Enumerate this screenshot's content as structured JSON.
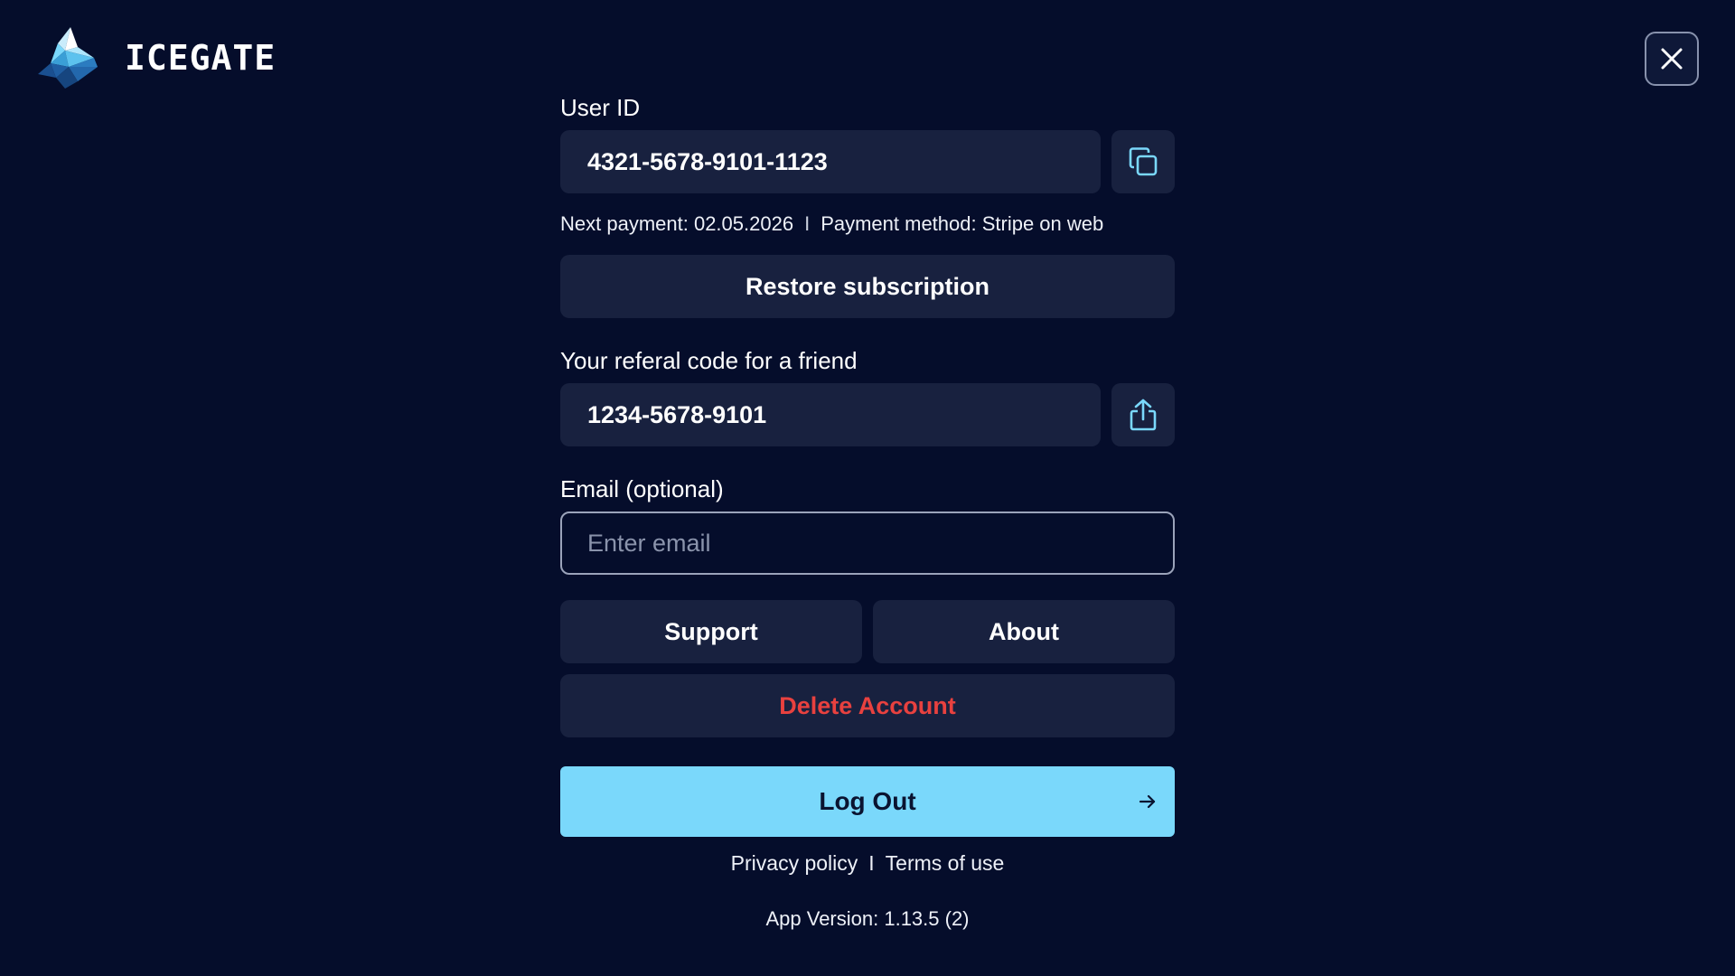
{
  "app": {
    "name": "ICEGATE"
  },
  "colors": {
    "background": "#050d2b",
    "field": "#18213f",
    "accent": "#7ad8fb",
    "danger": "#e8413f"
  },
  "icons": {
    "logo": "iceberg-logo-icon",
    "close": "close-icon",
    "copy": "copy-icon",
    "share": "share-icon",
    "logout": "arrow-right-icon"
  },
  "user_id": {
    "label": "User ID",
    "value": "4321-5678-9101-1123"
  },
  "payment": {
    "next_payment": "Next payment: 02.05.2026",
    "separator": "I",
    "method": "Payment method: Stripe on web"
  },
  "restore_subscription": "Restore subscription",
  "referral": {
    "label": "Your referal code for a friend",
    "value": "1234-5678-9101"
  },
  "email": {
    "label": "Email (optional)",
    "placeholder": "Enter email",
    "value": ""
  },
  "buttons": {
    "support": "Support",
    "about": "About",
    "delete_account": "Delete Account",
    "log_out": "Log Out"
  },
  "footer": {
    "privacy": "Privacy policy",
    "separator": "I",
    "terms": "Terms of use",
    "version": "App Version: 1.13.5 (2)"
  }
}
